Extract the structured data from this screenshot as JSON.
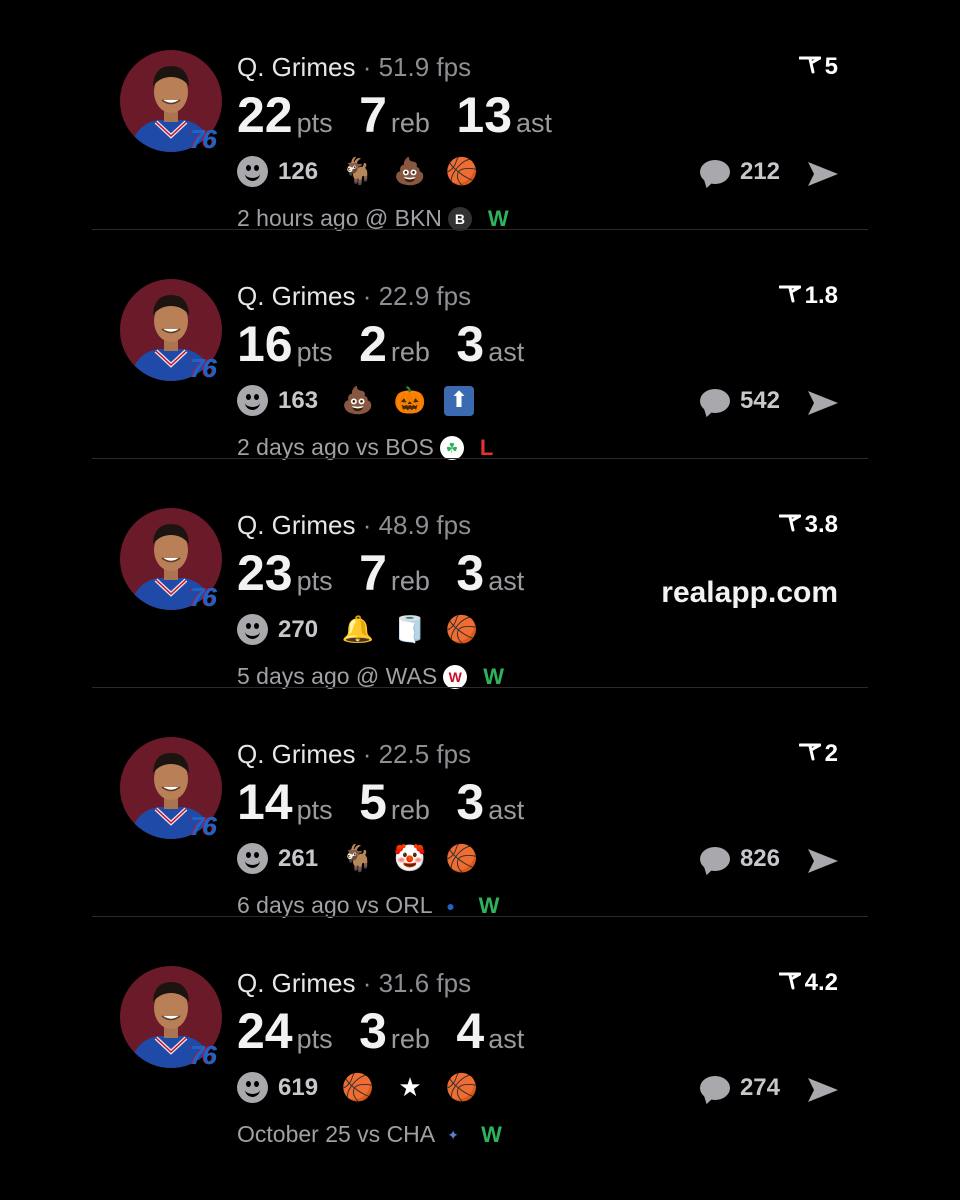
{
  "colors": {
    "win": "#2fb35a",
    "loss": "#e5322d",
    "background": "#000000"
  },
  "posts": [
    {
      "player": "Q. Grimes",
      "fps": "· 51.9 fps",
      "team_logo": "76",
      "pts": "22",
      "reb": "7",
      "ast": "13",
      "pts_label": "pts",
      "reb_label": "reb",
      "ast_label": "ast",
      "score": "5",
      "reaction_count": "126",
      "emojis": [
        "goat-emoji",
        "poop-emoji",
        "player-emoji"
      ],
      "emoji_glyphs": [
        "🐐",
        "💩",
        "🏀"
      ],
      "comments": "212",
      "meta": "2 hours ago @ BKN",
      "opp_logo": "B",
      "opp_logo_color": "#ffffff",
      "opp_logo_bg": "#333333",
      "result": "W"
    },
    {
      "player": "Q. Grimes",
      "fps": "· 22.9 fps",
      "team_logo": "76",
      "pts": "16",
      "reb": "2",
      "ast": "3",
      "pts_label": "pts",
      "reb_label": "reb",
      "ast_label": "ast",
      "score": "1.8",
      "reaction_count": "163",
      "emojis": [
        "poop-emoji",
        "jack-o-lantern-emoji",
        "up-arrow-emoji"
      ],
      "emoji_glyphs": [
        "💩",
        "🎃",
        "⬆"
      ],
      "comments": "542",
      "meta": "2 days ago vs BOS",
      "opp_logo": "☘",
      "opp_logo_color": "#2fb35a",
      "opp_logo_bg": "#ffffff",
      "result": "L"
    },
    {
      "player": "Q. Grimes",
      "fps": "· 48.9 fps",
      "team_logo": "76",
      "pts": "23",
      "reb": "7",
      "ast": "3",
      "pts_label": "pts",
      "reb_label": "reb",
      "ast_label": "ast",
      "score": "3.8",
      "reaction_count": "270",
      "emojis": [
        "bell-emoji",
        "toilet-paper-emoji",
        "player-emoji"
      ],
      "emoji_glyphs": [
        "🔔",
        "🧻",
        "🏀"
      ],
      "watermark": "realapp.com",
      "comments": "",
      "meta": "5 days ago @ WAS",
      "opp_logo": "W",
      "opp_logo_color": "#c8102e",
      "opp_logo_bg": "#ffffff",
      "result": "W"
    },
    {
      "player": "Q. Grimes",
      "fps": "· 22.5 fps",
      "team_logo": "76",
      "pts": "14",
      "reb": "5",
      "ast": "3",
      "pts_label": "pts",
      "reb_label": "reb",
      "ast_label": "ast",
      "score": "2",
      "reaction_count": "261",
      "emojis": [
        "goat-emoji",
        "clown-emoji",
        "player-emoji"
      ],
      "emoji_glyphs": [
        "🐐",
        "🤡",
        "🏀"
      ],
      "comments": "826",
      "meta": "6 days ago vs ORL",
      "opp_logo": "●",
      "opp_logo_color": "#1d64c9",
      "opp_logo_bg": "#000000",
      "result": "W"
    },
    {
      "player": "Q. Grimes",
      "fps": "· 31.6 fps",
      "team_logo": "76",
      "pts": "24",
      "reb": "3",
      "ast": "4",
      "pts_label": "pts",
      "reb_label": "reb",
      "ast_label": "ast",
      "score": "4.2",
      "reaction_count": "619",
      "emojis": [
        "player-emoji",
        "china-flag-emoji",
        "player-emoji"
      ],
      "emoji_glyphs": [
        "🏀",
        "★",
        "🏀"
      ],
      "comments": "274",
      "meta": "October 25 vs CHA",
      "opp_logo": "✦",
      "opp_logo_color": "#5b7fc9",
      "opp_logo_bg": "#000000",
      "result": "W"
    }
  ]
}
